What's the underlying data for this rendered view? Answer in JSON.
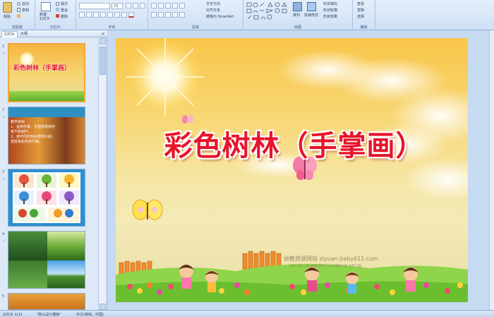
{
  "ribbon": {
    "clipboard": {
      "label": "剪贴板",
      "paste": "粘贴",
      "cut": "剪切",
      "copy": "复制",
      "format": "格式刷"
    },
    "slides": {
      "label": "幻灯片",
      "new_slide": "新建\n幻灯片",
      "layout": "版式",
      "reset": "重设",
      "delete": "删除"
    },
    "font": {
      "label": "字体",
      "size": "72"
    },
    "paragraph": {
      "label": "段落",
      "text_dir": "文字方向",
      "align_text": "对齐文本",
      "smartart": "转换为 SmartArt"
    },
    "drawing": {
      "label": "绘图",
      "arrange": "排列",
      "quick_styles": "快速样式",
      "fill": "形状填充",
      "outline": "形状轮廓",
      "effects": "形状效果"
    },
    "editing": {
      "label": "编辑",
      "find": "查找",
      "replace": "替换",
      "select": "选择"
    }
  },
  "panel": {
    "tab_slides": "幻灯片",
    "tab_outline": "大纲",
    "close": "×",
    "thumbs": [
      {
        "num": "1",
        "title": "彩色树林（手掌画）"
      },
      {
        "num": "2",
        "lines": [
          "教学目标",
          "1、运用手掌、手指表现树的",
          "枝干和树叶。",
          "2、用不同的色彩表现大树，",
          "感受色彩的快乐美。"
        ]
      },
      {
        "num": "3"
      },
      {
        "num": "4"
      },
      {
        "num": "5"
      }
    ]
  },
  "slide": {
    "title": "彩色树林（手掌画）",
    "watermark_site": "幼教资源网站  ziyuan.baby611.com",
    "watermark_sub": "课件下载  儿歌  故事MP3  FLASH课件下载  试卷下载"
  },
  "status": {
    "slide_count": "幻灯片 1/11",
    "theme": "\"默认设计模板\"",
    "language": "中文(简体，中国)"
  },
  "colors": {
    "title_red": "#e8142a",
    "ribbon_bg": "#cfe0f5",
    "selection": "#f3a73b"
  }
}
